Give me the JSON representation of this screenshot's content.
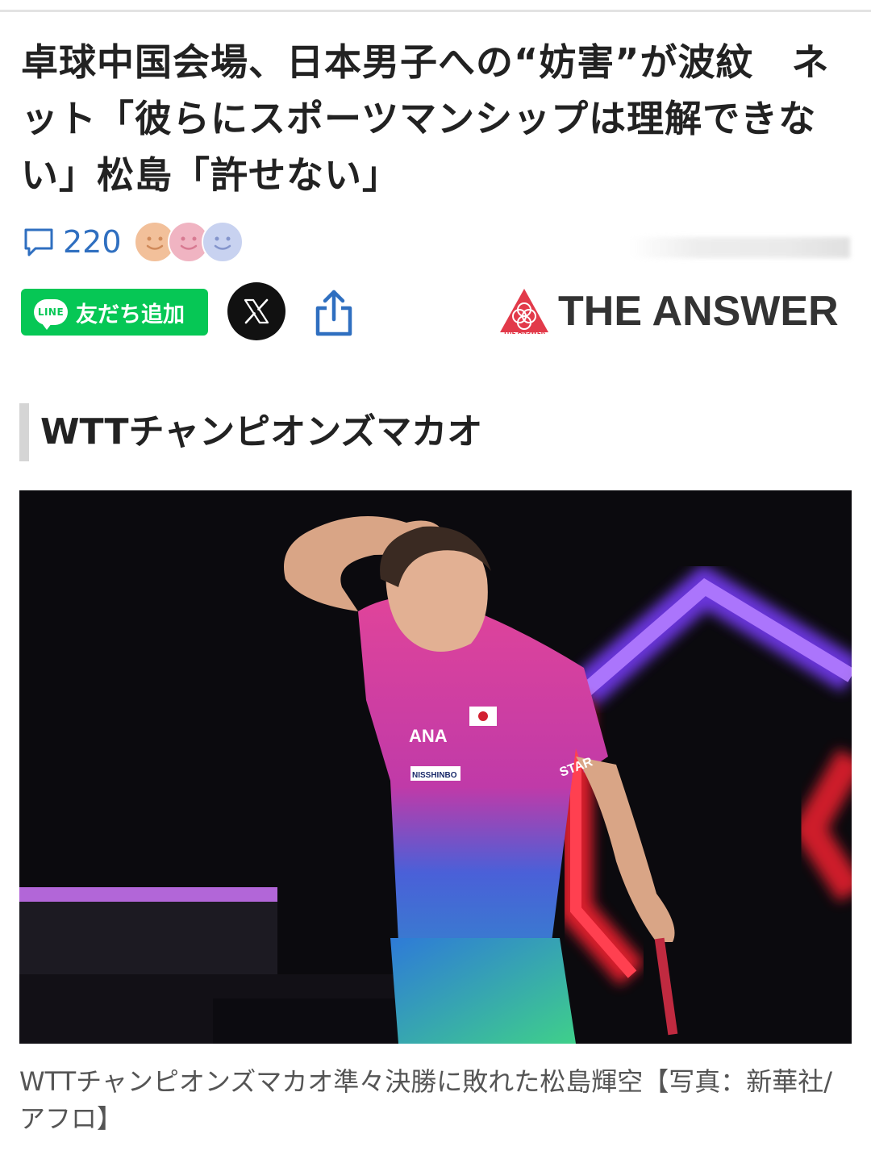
{
  "article": {
    "headline": "卓球中国会場、日本男子への“妨害”が波紋　ネット「彼らにスポーツマンシップは理解できない」松島「許せない」",
    "comment_count": "220",
    "section_title": "WTTチャンピオンズマカオ",
    "photo_caption": "WTTチャンピオンズマカオ準々決勝に敗れた松島輝空【写真：新華社/アフロ】"
  },
  "share": {
    "line_badge": "LINE",
    "line_label": "友だち追加"
  },
  "brand": {
    "name": "THE ANSWER",
    "mark_text": "THE ANSWER"
  },
  "photo_text": {
    "shirt_sponsor": "ANA",
    "shirt_sponsor2": "NISSHINBO",
    "sleeve": "STAR"
  },
  "colors": {
    "line_green": "#06c755",
    "comment_blue": "#2f6fc0",
    "brand_red": "#e23a4a",
    "reaction_faces": [
      "#f2c09a",
      "#f0b4c2",
      "#c8d2f0"
    ]
  },
  "icons": [
    "comment-icon",
    "smile-face-icon",
    "x-logo-icon",
    "share-icon",
    "answer-logo-icon"
  ]
}
